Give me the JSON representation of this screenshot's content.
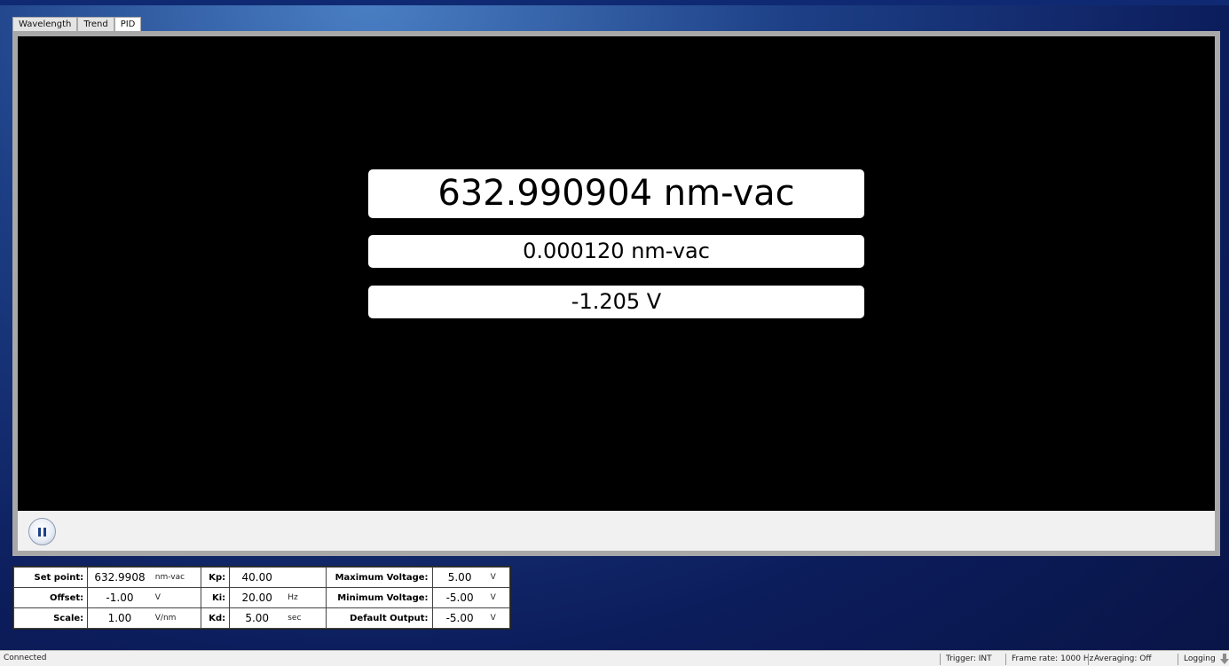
{
  "tabs": [
    {
      "label": "Wavelength",
      "active": false
    },
    {
      "label": "Trend",
      "active": false
    },
    {
      "label": "PID",
      "active": true
    }
  ],
  "readouts": {
    "wavelength": "632.990904 nm-vac",
    "deviation": "0.000120 nm-vac",
    "voltage": "-1.205 V"
  },
  "controls": {
    "pause_icon": "pause-icon"
  },
  "params": {
    "set_point": {
      "label": "Set point:",
      "value": "632.9908",
      "unit": "nm-vac"
    },
    "offset": {
      "label": "Offset:",
      "value": "-1.00",
      "unit": "V"
    },
    "scale": {
      "label": "Scale:",
      "value": "1.00",
      "unit": "V/nm"
    },
    "kp": {
      "label": "Kp:",
      "value": "40.00",
      "unit": ""
    },
    "ki": {
      "label": "Ki:",
      "value": "20.00",
      "unit": "Hz"
    },
    "kd": {
      "label": "Kd:",
      "value": "5.00",
      "unit": "sec"
    },
    "max_voltage": {
      "label": "Maximum Voltage:",
      "value": "5.00",
      "unit": "V"
    },
    "min_voltage": {
      "label": "Minimum Voltage:",
      "value": "-5.00",
      "unit": "V"
    },
    "default_output": {
      "label": "Default Output:",
      "value": "-5.00",
      "unit": "V"
    }
  },
  "status": {
    "connection": "Connected",
    "trigger": "Trigger:  INT",
    "frame_rate": "Frame rate:  1000 Hz",
    "averaging": "Averaging:  Off",
    "logging": "Logging",
    "logging_icon": "download-arrow-icon"
  },
  "colors": {
    "background_top": "#4a7fc4",
    "background_bottom": "#091446",
    "display_bg": "#000000",
    "readout_bg": "#ffffff"
  }
}
